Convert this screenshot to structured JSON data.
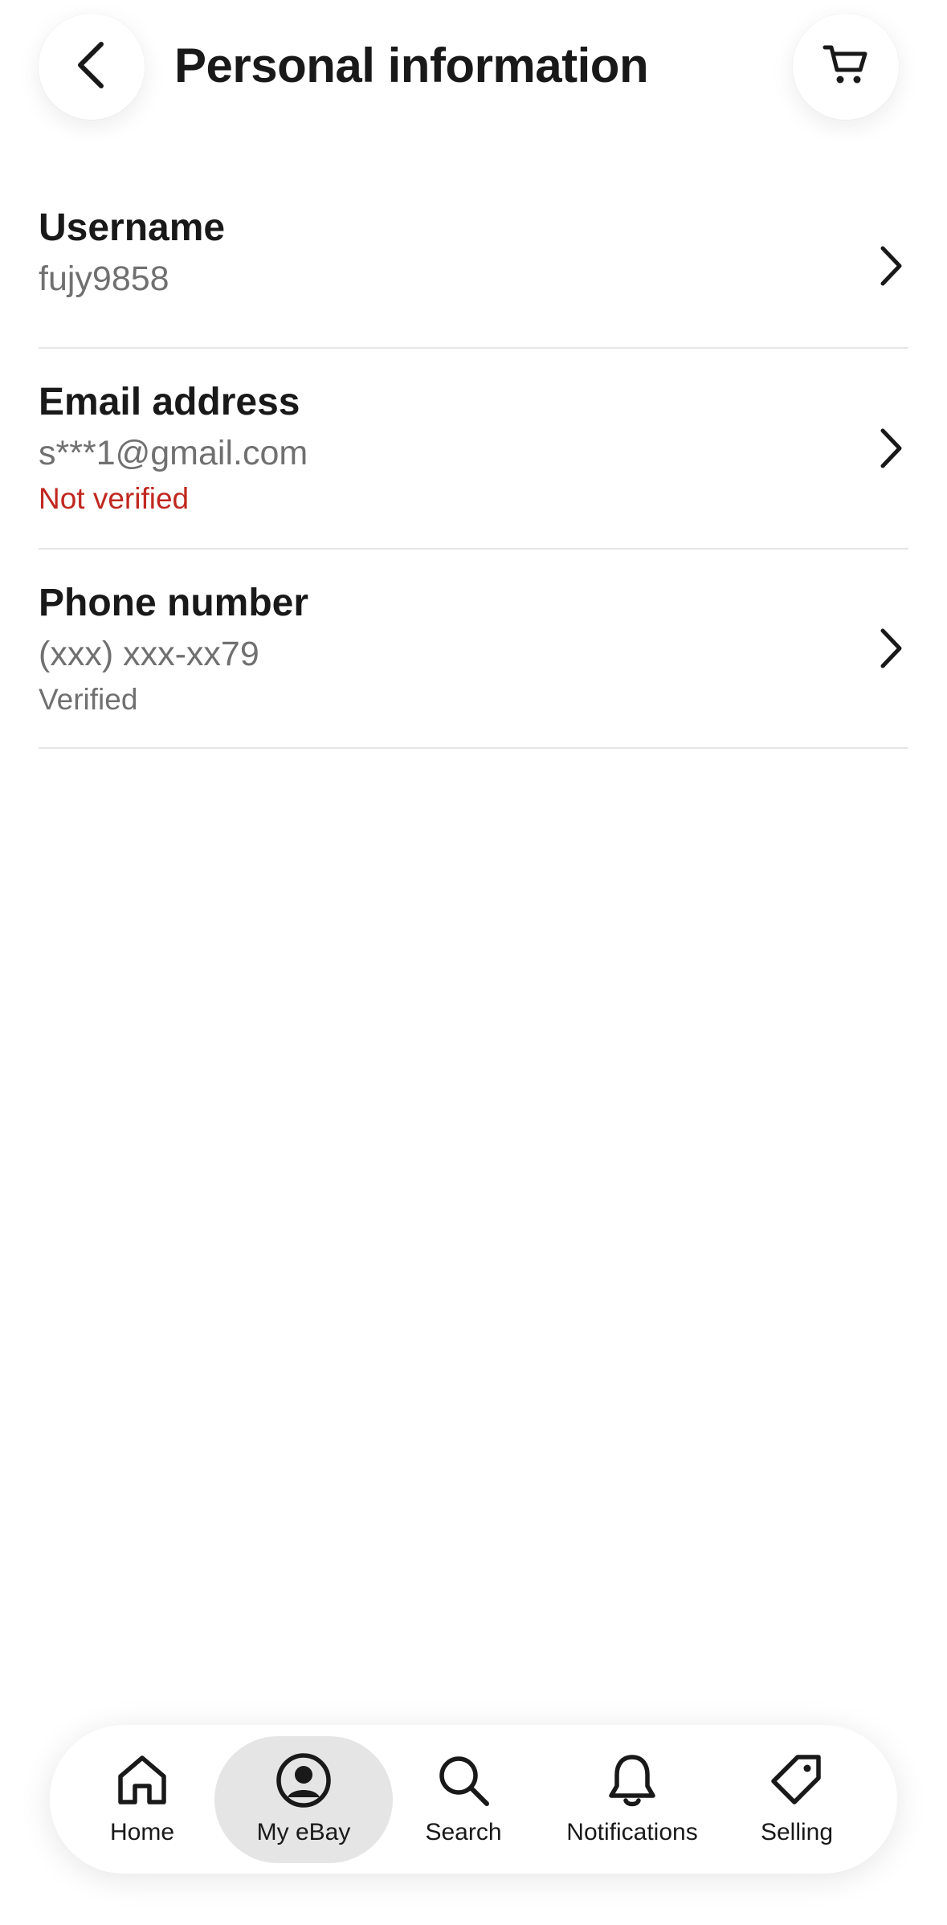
{
  "header": {
    "title": "Personal information",
    "back_icon": "chevron-left-icon",
    "cart_icon": "cart-icon"
  },
  "fields": [
    {
      "label": "Username",
      "value": "fujy9858",
      "status": ""
    },
    {
      "label": "Email address",
      "value": "s***1@gmail.com",
      "status": "Not verified",
      "status_color": "#c0281f"
    },
    {
      "label": "Phone number",
      "value": "(xxx) xxx-xx79",
      "status": "Verified",
      "status_color": "#707070"
    }
  ],
  "bottom_nav": {
    "items": [
      {
        "label": "Home",
        "icon": "home-icon",
        "selected": false
      },
      {
        "label": "My eBay",
        "icon": "account-icon",
        "selected": true
      },
      {
        "label": "Search",
        "icon": "search-icon",
        "selected": false
      },
      {
        "label": "Notifications",
        "icon": "bell-icon",
        "selected": false
      },
      {
        "label": "Selling",
        "icon": "tag-icon",
        "selected": false
      }
    ]
  },
  "colors": {
    "text": "#191919",
    "secondary_text": "#707070",
    "error": "#c0281f",
    "divider": "#e5e5e5",
    "selected_pill": "#e5e5e5"
  }
}
